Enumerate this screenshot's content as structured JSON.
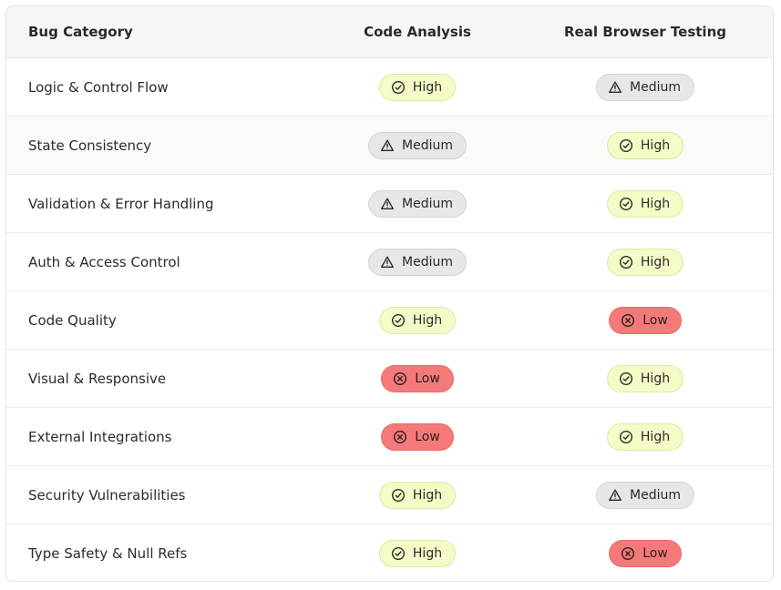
{
  "table": {
    "headers": [
      "Bug Category",
      "Code Analysis",
      "Real Browser Testing"
    ],
    "rows": [
      {
        "category": "Logic & Control Flow",
        "code": "High",
        "real": "Medium"
      },
      {
        "category": "State Consistency",
        "code": "Medium",
        "real": "High"
      },
      {
        "category": "Validation & Error Handling",
        "code": "Medium",
        "real": "High"
      },
      {
        "category": "Auth & Access Control",
        "code": "Medium",
        "real": "High"
      },
      {
        "category": "Code Quality",
        "code": "High",
        "real": "Low"
      },
      {
        "category": "Visual & Responsive",
        "code": "Low",
        "real": "High"
      },
      {
        "category": "External Integrations",
        "code": "Low",
        "real": "High"
      },
      {
        "category": "Security Vulnerabilities",
        "code": "High",
        "real": "Medium"
      },
      {
        "category": "Type Safety & Null Refs",
        "code": "High",
        "real": "Low"
      }
    ]
  },
  "ratings": {
    "High": {
      "icon": "check-circle-icon",
      "color": "#f4fbc7"
    },
    "Medium": {
      "icon": "warning-triangle-icon",
      "color": "#e7e7e5"
    },
    "Low": {
      "icon": "x-circle-icon",
      "color": "#f57979"
    }
  }
}
